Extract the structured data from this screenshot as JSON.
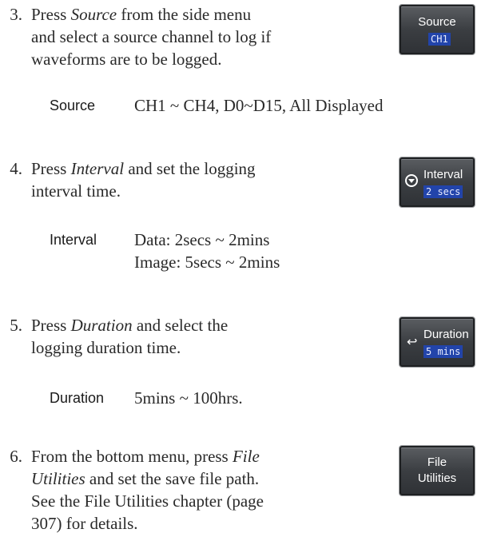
{
  "steps": [
    {
      "number": "3.",
      "lines": [
        "Press ",
        "Source",
        " from the side menu",
        "and select a source channel to log if",
        "waveforms are to be logged."
      ],
      "param": {
        "label": "Source",
        "values": [
          "CH1 ~ CH4, D0~D15, All Displayed"
        ]
      },
      "softkey": {
        "title": "Source",
        "value": "CH1",
        "icon": "none"
      }
    },
    {
      "number": "4.",
      "lines": [
        "Press ",
        "Interval",
        " and set the logging",
        "interval time."
      ],
      "param": {
        "label": "Interval",
        "values": [
          "Data: 2secs ~ 2mins",
          "Image:  5secs ~ 2mins"
        ]
      },
      "softkey": {
        "title": "Interval",
        "value": "2 secs",
        "icon": "variable-knob-icon"
      }
    },
    {
      "number": "5.",
      "lines": [
        "Press ",
        "Duration",
        " and select the",
        "logging duration time."
      ],
      "param": {
        "label": "Duration",
        "values": [
          "5mins ~ 100hrs."
        ]
      },
      "softkey": {
        "title": "Duration",
        "value": "5 mins",
        "icon": "return-arrow-icon"
      }
    },
    {
      "number": "6.",
      "lines": [
        "From the bottom menu, press ",
        "File",
        "Utilities",
        " and set the save file path.",
        "See the File Utilities chapter (page",
        "307) for details."
      ],
      "softkey": {
        "title1": "File",
        "title2": "Utilities"
      }
    }
  ]
}
